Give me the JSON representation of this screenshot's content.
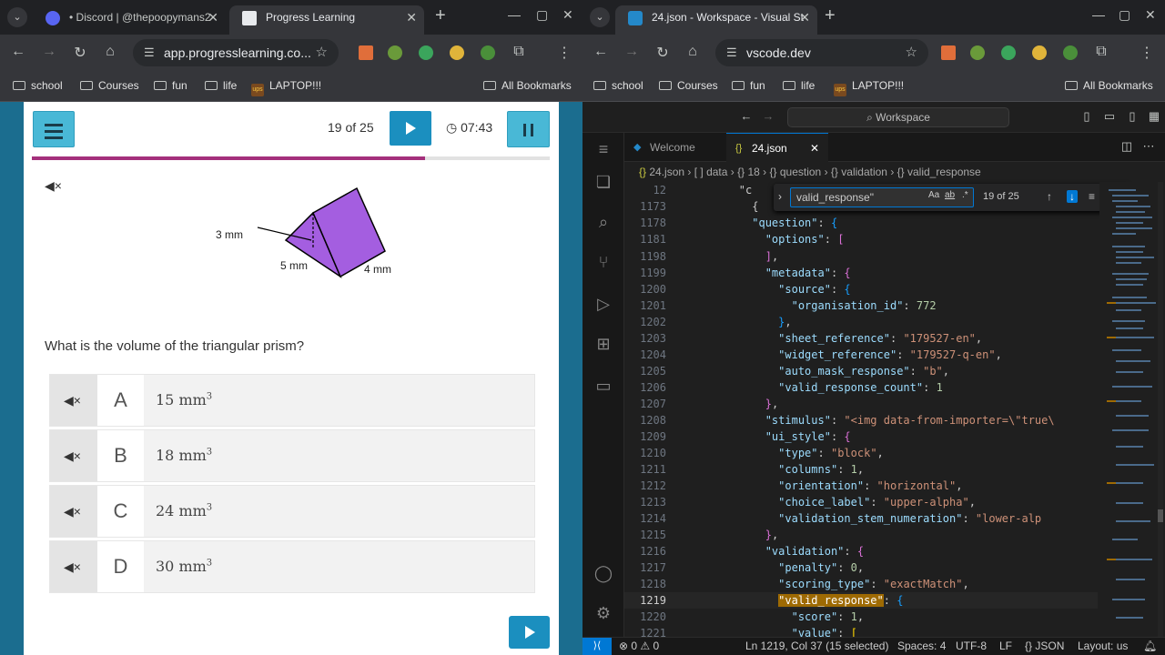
{
  "left_browser": {
    "tabs": [
      {
        "title": "• Discord | @thepoopymans2"
      },
      {
        "title": "Progress Learning"
      }
    ],
    "url": "app.progresslearning.co...",
    "bookmarks": [
      "school",
      "Courses",
      "fun",
      "life",
      "LAPTOP!!!"
    ],
    "all_bookmarks": "All Bookmarks"
  },
  "quiz": {
    "counter": "19 of 25",
    "timer": "07:43",
    "progress_fraction": 0.76,
    "figure_labels": {
      "a": "3 mm",
      "b": "5 mm",
      "c": "4 mm"
    },
    "question": "What is the volume of the triangular prism?",
    "options": [
      {
        "letter": "A",
        "value": "15 mm",
        "sup": "3"
      },
      {
        "letter": "B",
        "value": "18 mm",
        "sup": "3"
      },
      {
        "letter": "C",
        "value": "24 mm",
        "sup": "3"
      },
      {
        "letter": "D",
        "value": "30 mm",
        "sup": "3"
      }
    ]
  },
  "right_browser": {
    "tab_title": "24.json - Workspace - Visual St",
    "url": "vscode.dev",
    "bookmarks": [
      "school",
      "Courses",
      "fun",
      "life",
      "LAPTOP!!!"
    ],
    "all_bookmarks": "All Bookmarks"
  },
  "vscode": {
    "command_center": "Workspace",
    "tabs": [
      {
        "label": "Welcome"
      },
      {
        "label": "24.json"
      }
    ],
    "breadcrumb": [
      "24.json",
      "data",
      "18",
      "question",
      "validation",
      "valid_response"
    ],
    "find": {
      "query": "valid_response\"",
      "count": "19 of 25",
      "case": "Aa",
      "word": "ab",
      "regex": ".*"
    },
    "status": {
      "errors": "0",
      "warnings": "0",
      "position": "Ln 1219, Col 37 (15 selected)",
      "spaces": "Spaces: 4",
      "encoding": "UTF-8",
      "eol": "LF",
      "language": "JSON",
      "layout": "Layout: us"
    }
  }
}
